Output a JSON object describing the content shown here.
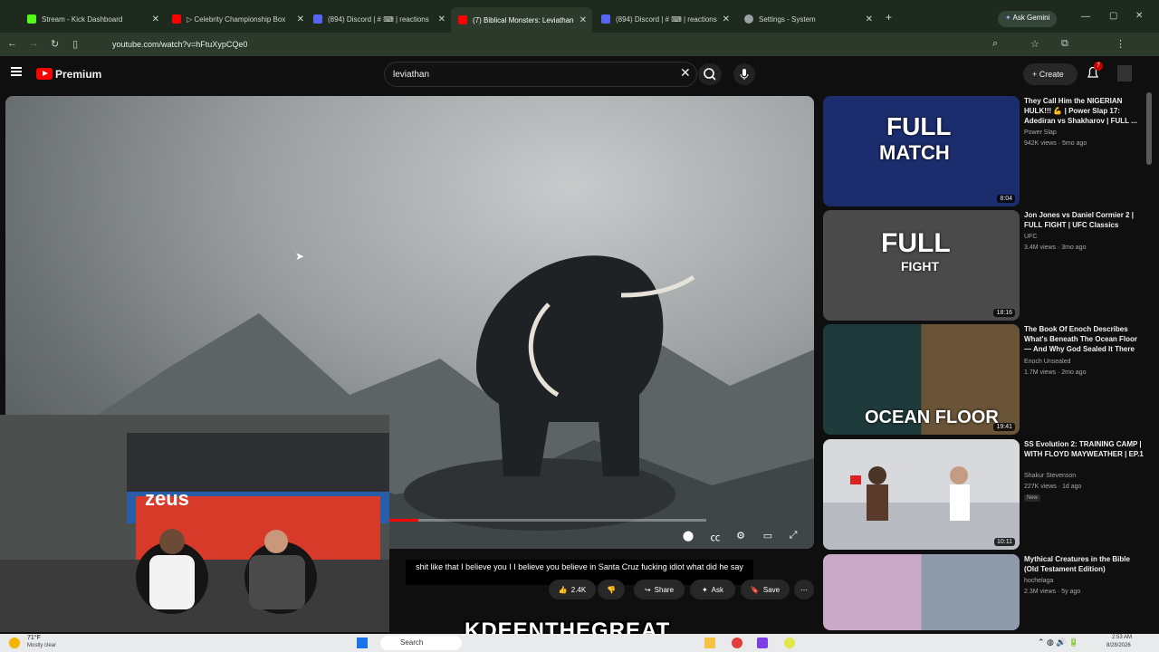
{
  "browser": {
    "tabs": [
      {
        "label": "Stream - Kick Dashboard",
        "color": "#53fc18"
      },
      {
        "label": "▷ Celebrity Championship Box",
        "color": "#ff0000"
      },
      {
        "label": "(894) Discord | # ⌨ | reactions",
        "color": "#5865f2"
      },
      {
        "label": "(7) Biblical Monsters: Leviathan",
        "color": "#ff0000"
      },
      {
        "label": "(894) Discord | # ⌨ | reactions",
        "color": "#5865f2"
      },
      {
        "label": "Settings - System",
        "color": "#9aa0a6"
      }
    ],
    "active_tab_index": 3,
    "ask_gemini": "Ask Gemini",
    "url": "youtube.com/watch?v=hFtuXypCQe0"
  },
  "youtube": {
    "brand": "Premium",
    "search_value": "leviathan",
    "create_label": "Create",
    "notification_count": "7"
  },
  "player": {
    "progress": 0.09,
    "caption": "shit like that I believe you I I believe you believe in Santa Cruz fucking idiot what did he say"
  },
  "actions": {
    "likes": "2.4K",
    "share": "Share",
    "ask": "Ask",
    "save": "Save"
  },
  "webcam": {
    "banner": "zeus"
  },
  "sidebar": [
    {
      "title": "They Call Him the NIGERIAN HULK!!! 💪 | Power Slap 17: Adediran vs Shakharov | FULL ...",
      "channel": "Power Slap",
      "meta": "942K views · 5mo ago",
      "duration": "8:04",
      "thumb_text": [
        "FULL",
        "MATCH"
      ],
      "thumb_color": "#1c2d6e"
    },
    {
      "title": "Jon Jones vs Daniel Cormier 2 | FULL FIGHT | UFC Classics",
      "channel": "UFC",
      "meta": "3.4M views · 3mo ago",
      "duration": "18:16",
      "thumb_text": [
        "FULL",
        "FIGHT"
      ],
      "thumb_color": "#4a4a4a"
    },
    {
      "title": "The Book Of Enoch Describes What's Beneath The Ocean Floor — And Why God Sealed It There",
      "channel": "Enoch Unsealed",
      "meta": "1.7M views · 2mo ago",
      "duration": "19:41",
      "thumb_text": [
        "OCEAN FLOOR"
      ],
      "thumb_color": "#1f3a3a"
    },
    {
      "title": "SS Evolution 2: TRAINING CAMP | WITH FLOYD MAYWEATHER | EP.1",
      "channel": "Shakur Stevenson",
      "meta": "227K views · 1d ago",
      "duration": "10:11",
      "badge": "New",
      "thumb_color": "#d7d9dc"
    },
    {
      "title": "Mythical Creatures in the Bible (Old Testament Edition)",
      "channel": "hochelaga",
      "meta": "2.3M views · 5y ago",
      "duration": "",
      "thumb_color": "#c9a8c8"
    }
  ],
  "overlay_brand": "KDEENTHEGREAT",
  "taskbar": {
    "temp": "71°F",
    "weather": "Mostly clear",
    "search": "Search",
    "time": "2:53 AM",
    "date": "8/28/2026"
  }
}
